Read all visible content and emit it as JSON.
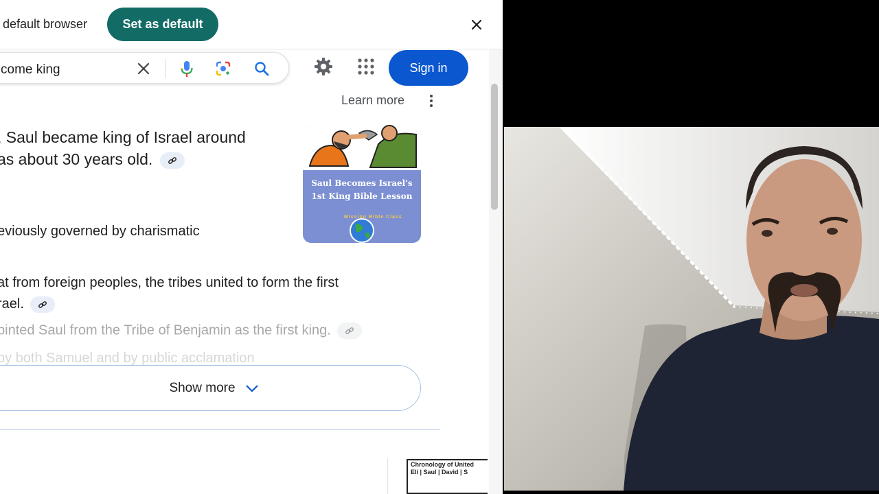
{
  "banner": {
    "message": "default browser",
    "set_default_label": "Set as default",
    "close_icon": "close-icon"
  },
  "search": {
    "query": "come king",
    "icons": [
      "clear-icon",
      "mic-icon",
      "lens-icon",
      "search-icon"
    ],
    "sign_in_label": "Sign in"
  },
  "overview": {
    "learn_more": "Learn more",
    "line1": ", Saul became king of Israel around",
    "line1b": "as about 30 years old.",
    "line2": "eviously governed by charismatic",
    "line3": "at from foreign peoples, the tribes united to form the first",
    "line3b": "rael.",
    "line4": "binted Saul from the Tribe of Benjamin as the first king.",
    "line5": "by both Samuel and by public acclamation",
    "image_title": "Saul Becomes Israel's 1st King Bible Lesson",
    "image_badge": "Mission Bible Class",
    "show_more": "Show more"
  },
  "related": {
    "chronology_title": "Chronology of United",
    "chronology_row": "Eli | Saul | David | S"
  },
  "colors": {
    "set_default_bg": "#136b65",
    "sign_in_bg": "#0b57d0",
    "link_chip_bg": "#e8eef8"
  }
}
